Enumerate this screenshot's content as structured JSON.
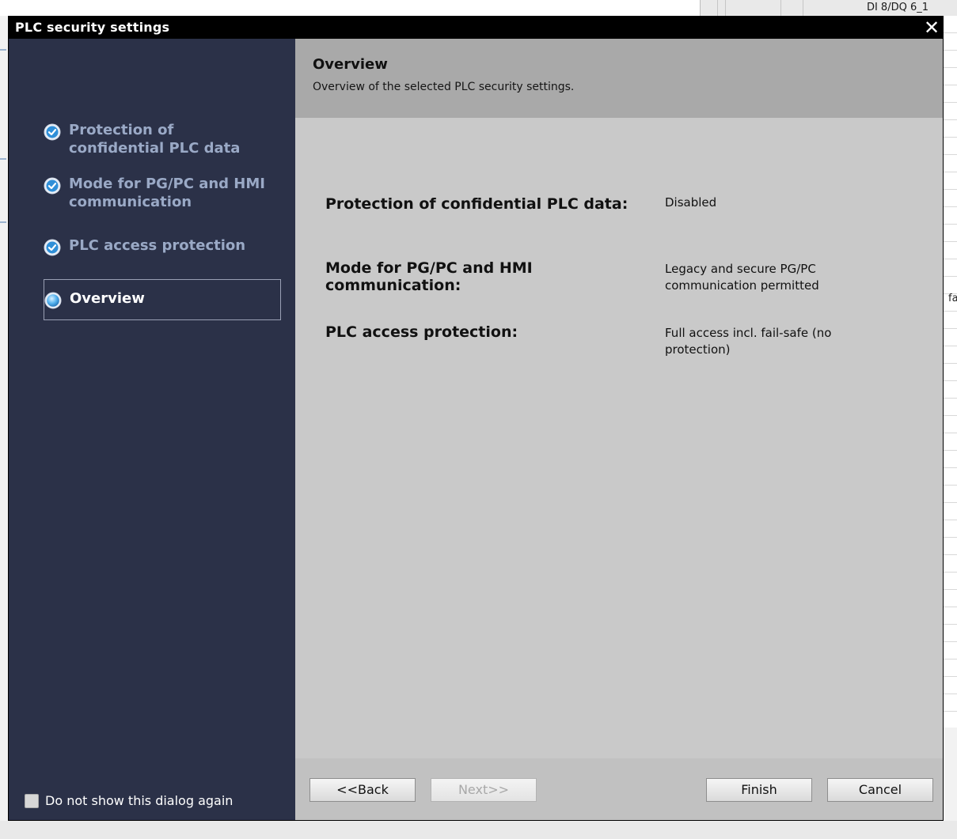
{
  "background": {
    "module_label": "DI 8/DQ 6_1",
    "side_fragment": "fa"
  },
  "dialog": {
    "title": "PLC security settings",
    "close_glyph": "✕"
  },
  "nav": {
    "items": [
      {
        "label": "Protection of confidential PLC data",
        "state": "done",
        "icon": "check-circle-icon"
      },
      {
        "label": "Mode for PG/PC and HMI communication",
        "state": "done",
        "icon": "check-circle-icon"
      },
      {
        "label": "PLC access protection",
        "state": "done",
        "icon": "check-circle-icon"
      },
      {
        "label": "Overview",
        "state": "active",
        "icon": "current-step-icon"
      }
    ],
    "dont_show_label": "Do not show this dialog again"
  },
  "header": {
    "title": "Overview",
    "subtitle": "Overview of the selected PLC security settings."
  },
  "summary": [
    {
      "label": "Protection of confidential PLC data:",
      "value": "Disabled"
    },
    {
      "label": "Mode for PG/PC and HMI communication:",
      "value": "Legacy and secure PG/PC communication permitted"
    },
    {
      "label": "PLC access protection:",
      "value": "Full access incl. fail-safe (no protection)"
    }
  ],
  "footer": {
    "back_label": "<<Back",
    "next_label": "Next>>",
    "finish_label": "Finish",
    "cancel_label": "Cancel"
  },
  "colors": {
    "nav_bg": "#2b3148",
    "nav_text": "#9aa9c6",
    "content_bg": "#c9c9c9",
    "header_bg": "#a9a9a9",
    "check_icon": "#2f8fd8"
  }
}
